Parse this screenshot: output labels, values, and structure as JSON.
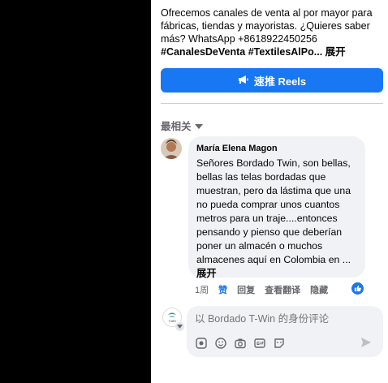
{
  "post": {
    "text_line1": "Ofrecemos canales de venta al por mayor para fábricas, tiendas y mayoristas. ¿Quieres saber más? WhatsApp +8618922450256",
    "hashtags": "#CanalesDeVenta #TextilesAlPo...",
    "see_more": "展开",
    "boost_label": "速推 Reels"
  },
  "comments": {
    "sort_label": "最相关",
    "items": [
      {
        "author": "María Elena Magon",
        "text": "Señores Bordado Twin, son bellas, bellas las telas bordadas que muestran, pero da lástima que una no pueda comprar unos cuantos metros para un traje....entonces pensando y pienso que deberían poner un almacén o muchos almacenes aquí en Colombia en ...",
        "expand": "展开",
        "time": "1周",
        "like": "赞",
        "reply": "回复",
        "translate": "查看翻译",
        "hide": "隐藏"
      }
    ]
  },
  "composer": {
    "placeholder": "以 Bordado T-Win 的身份评论",
    "avatar_text": "T-WIN"
  },
  "colors": {
    "accent": "#1877f2",
    "bubble": "#f0f2f5",
    "muted": "#65676b"
  }
}
